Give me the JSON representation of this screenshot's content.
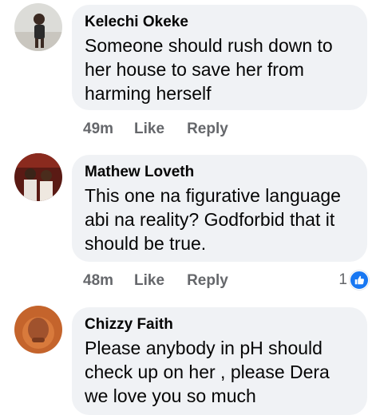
{
  "comments": [
    {
      "author": "Kelechi Okeke",
      "text": "Someone should rush down to her house to save her from harming herself",
      "time": "49m",
      "like_label": "Like",
      "reply_label": "Reply"
    },
    {
      "author": "Mathew Loveth",
      "text": "This one na figurative language abi na reality? Godforbid that it should be true.",
      "time": "48m",
      "like_label": "Like",
      "reply_label": "Reply",
      "reaction_count": "1",
      "reaction_icon": "thumbs-up-icon"
    },
    {
      "author": "Chizzy Faith",
      "text": "Please anybody in pH should check up on her , please Dera we love you so much"
    }
  ],
  "colors": {
    "bubble": "#f0f2f5",
    "text": "#050505",
    "meta": "#65676b",
    "reaction": "#1877f2"
  }
}
